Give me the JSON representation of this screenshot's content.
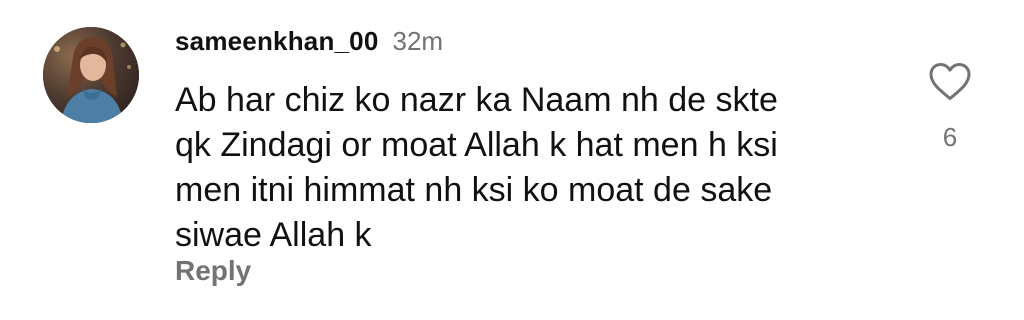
{
  "comment": {
    "username": "sameenkhan_00",
    "timestamp": "32m",
    "text_lines": [
      "Ab har chiz ko nazr ka Naam nh de skte",
      "qk Zindagi or moat Allah k hat men h ksi",
      "men itni himmat nh ksi ko moat de sake",
      "siwae Allah k"
    ],
    "reply_label": "Reply",
    "like_count": "6",
    "icons": {
      "like": "heart-outline-icon",
      "avatar": "profile-photo"
    },
    "colors": {
      "text": "#111111",
      "muted": "#737373",
      "background": "#ffffff"
    }
  }
}
